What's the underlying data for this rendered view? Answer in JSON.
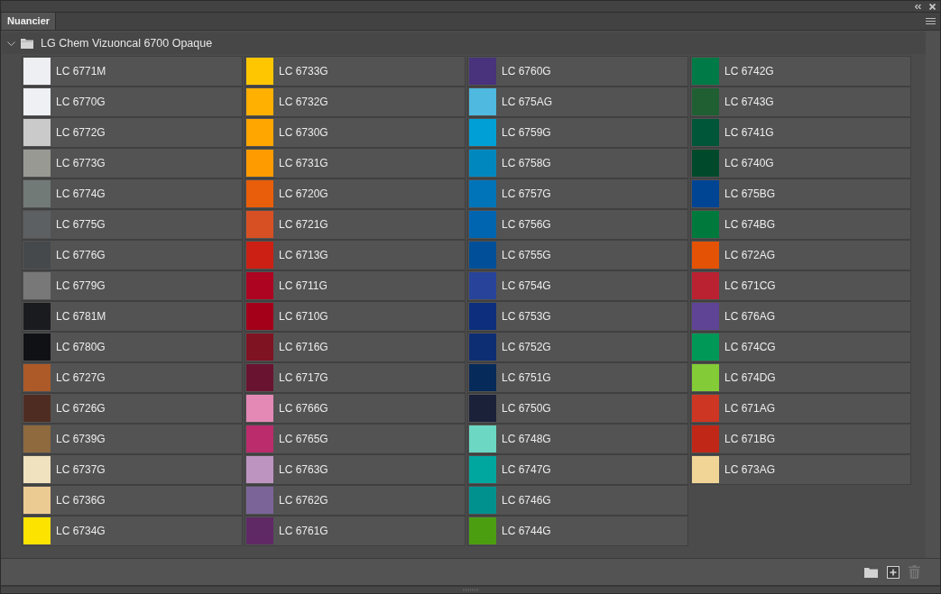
{
  "panel": {
    "tabs": [
      {
        "label": "Nuancier",
        "selected": true
      }
    ],
    "group": {
      "name": "LG Chem Vizuoncal 6700 Opaque",
      "expanded": true,
      "swatches": [
        {
          "name": "LC 6771M",
          "color": "#eeeff3"
        },
        {
          "name": "LC 6770G",
          "color": "#eff0f4"
        },
        {
          "name": "LC 6772G",
          "color": "#cacaca"
        },
        {
          "name": "LC 6773G",
          "color": "#999994"
        },
        {
          "name": "LC 6774G",
          "color": "#727a78"
        },
        {
          "name": "LC 6775G",
          "color": "#5c6062"
        },
        {
          "name": "LC 6776G",
          "color": "#45494c"
        },
        {
          "name": "LC 6779G",
          "color": "#787878"
        },
        {
          "name": "LC 6781M",
          "color": "#1a1b1e"
        },
        {
          "name": "LC 6780G",
          "color": "#101114"
        },
        {
          "name": "LC 6727G",
          "color": "#ad5a28"
        },
        {
          "name": "LC 6726G",
          "color": "#4f2c22"
        },
        {
          "name": "LC 6739G",
          "color": "#8f6a3e"
        },
        {
          "name": "LC 6737G",
          "color": "#f0e1bf"
        },
        {
          "name": "LC 6736G",
          "color": "#eccb93"
        },
        {
          "name": "LC 6734G",
          "color": "#fde300"
        },
        {
          "name": "LC 6733G",
          "color": "#fec600"
        },
        {
          "name": "LC 6732G",
          "color": "#ffb000"
        },
        {
          "name": "LC 6730G",
          "color": "#ffa600"
        },
        {
          "name": "LC 6731G",
          "color": "#fe9b00"
        },
        {
          "name": "LC 6720G",
          "color": "#e95e0a"
        },
        {
          "name": "LC 6721G",
          "color": "#d75024"
        },
        {
          "name": "LC 6713G",
          "color": "#cc2015"
        },
        {
          "name": "LC 6711G",
          "color": "#ad0421"
        },
        {
          "name": "LC 6710G",
          "color": "#a4001a"
        },
        {
          "name": "LC 6716G",
          "color": "#7f1322"
        },
        {
          "name": "LC 6717G",
          "color": "#6a1331"
        },
        {
          "name": "LC 6766G",
          "color": "#e489b6"
        },
        {
          "name": "LC 6765G",
          "color": "#ba2c6b"
        },
        {
          "name": "LC 6763G",
          "color": "#bd94c0"
        },
        {
          "name": "LC 6762G",
          "color": "#7b6598"
        },
        {
          "name": "LC 6761G",
          "color": "#5f2966"
        },
        {
          "name": "LC 6760G",
          "color": "#48337c"
        },
        {
          "name": "LC 675AG",
          "color": "#4fb9e0"
        },
        {
          "name": "LC 6759G",
          "color": "#00a0d6"
        },
        {
          "name": "LC 6758G",
          "color": "#0088be"
        },
        {
          "name": "LC 6757G",
          "color": "#0074b8"
        },
        {
          "name": "LC 6756G",
          "color": "#0065b1"
        },
        {
          "name": "LC 6755G",
          "color": "#004f98"
        },
        {
          "name": "LC 6754G",
          "color": "#27449a"
        },
        {
          "name": "LC 6753G",
          "color": "#0c2e7c"
        },
        {
          "name": "LC 6752G",
          "color": "#0e2e73"
        },
        {
          "name": "LC 6751G",
          "color": "#062a59"
        },
        {
          "name": "LC 6750G",
          "color": "#1a2139"
        },
        {
          "name": "LC 6748G",
          "color": "#6cd8c3"
        },
        {
          "name": "LC 6747G",
          "color": "#00a79f"
        },
        {
          "name": "LC 6746G",
          "color": "#00918f"
        },
        {
          "name": "LC 6744G",
          "color": "#4c9e11"
        },
        {
          "name": "LC 6742G",
          "color": "#007a46"
        },
        {
          "name": "LC 6743G",
          "color": "#1f5f32"
        },
        {
          "name": "LC 6741G",
          "color": "#005639"
        },
        {
          "name": "LC 6740G",
          "color": "#004a2b"
        },
        {
          "name": "LC 675BG",
          "color": "#004494"
        },
        {
          "name": "LC 674BG",
          "color": "#007a3c"
        },
        {
          "name": "LC 672AG",
          "color": "#e35205"
        },
        {
          "name": "LC 671CG",
          "color": "#ba2131"
        },
        {
          "name": "LC 676AG",
          "color": "#5f4495"
        },
        {
          "name": "LC 674CG",
          "color": "#009857"
        },
        {
          "name": "LC 674DG",
          "color": "#84cc37"
        },
        {
          "name": "LC 671AG",
          "color": "#cc3622"
        },
        {
          "name": "LC 671BG",
          "color": "#c02717"
        },
        {
          "name": "LC 673AG",
          "color": "#f0d597"
        }
      ]
    },
    "footer_buttons": [
      {
        "kind": "folder",
        "disabled": false
      },
      {
        "kind": "new",
        "disabled": false
      },
      {
        "kind": "delete",
        "disabled": true
      }
    ]
  }
}
